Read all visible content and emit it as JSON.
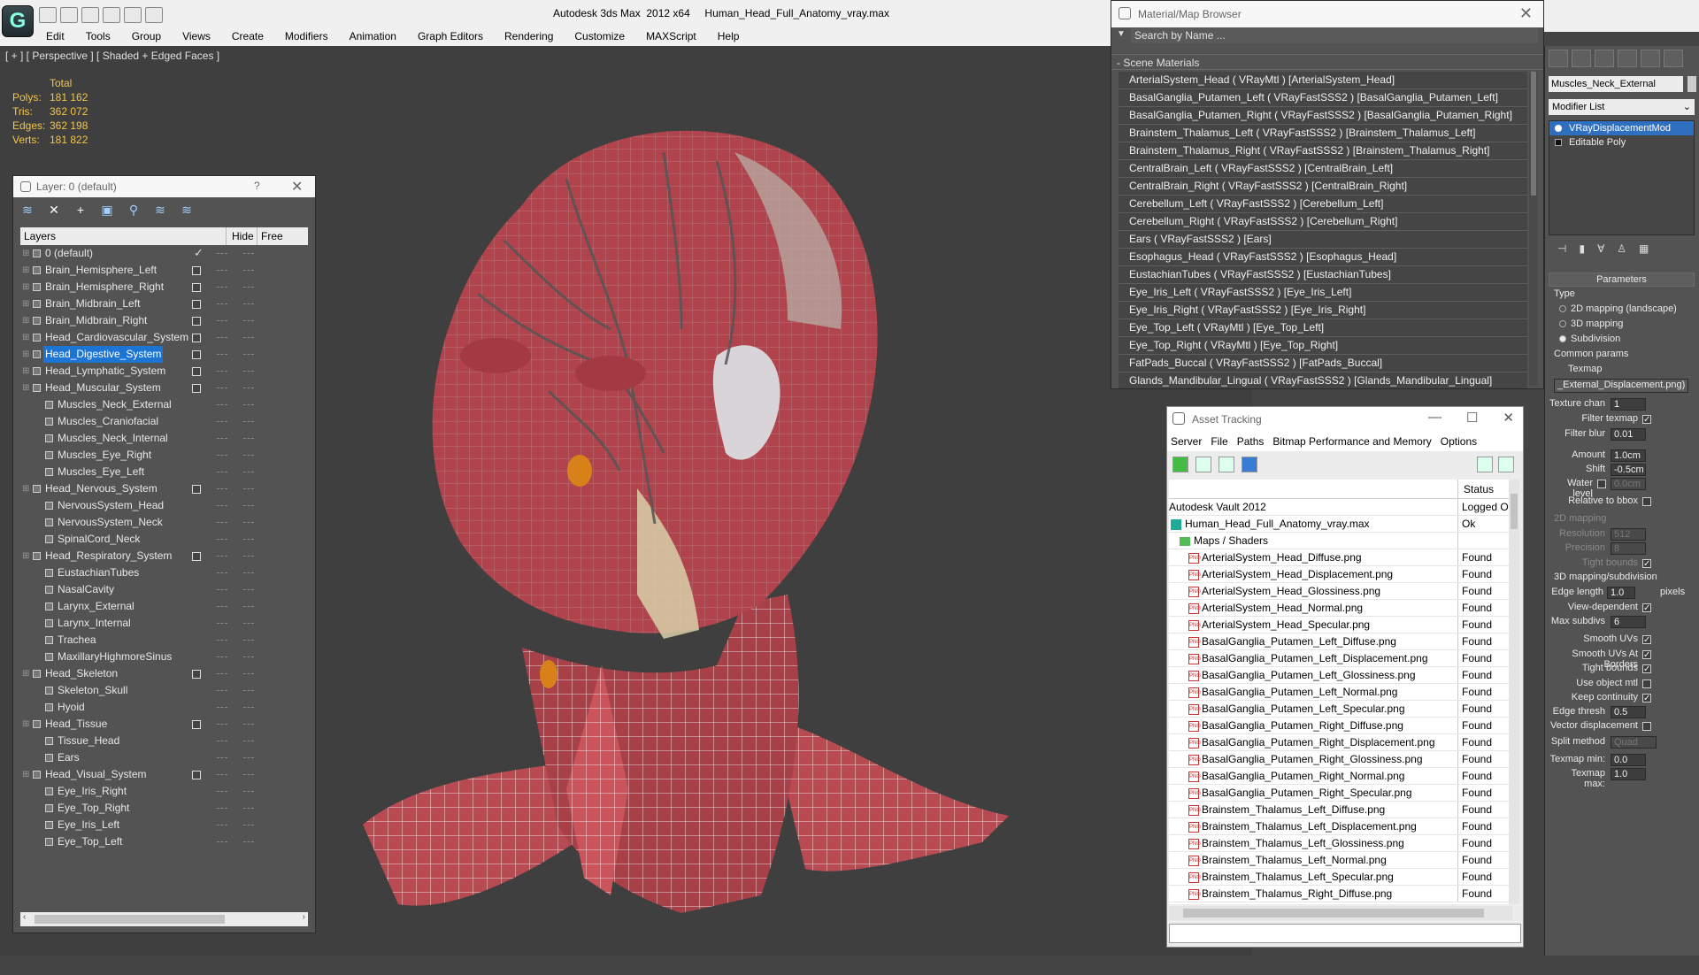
{
  "window": {
    "title": "Autodesk 3ds Max  2012 x64     Human_Head_Full_Anatomy_vray.max"
  },
  "menu": [
    "Edit",
    "Tools",
    "Group",
    "Views",
    "Create",
    "Modifiers",
    "Animation",
    "Graph Editors",
    "Rendering",
    "Customize",
    "MAXScript",
    "Help"
  ],
  "viewport": {
    "label": "[ + ] [ Perspective ] [ Shaded + Edged Faces ]",
    "stats": {
      "header": "Total",
      "rows": [
        {
          "k": "Polys:",
          "v": "181 162"
        },
        {
          "k": "Tris:",
          "v": "362 072"
        },
        {
          "k": "Edges:",
          "v": "362 198"
        },
        {
          "k": "Verts:",
          "v": "181 822"
        }
      ]
    }
  },
  "layer_panel": {
    "title": "Layer: 0 (default)",
    "help": "?",
    "col_layers": "Layers",
    "col_hide": "Hide",
    "col_freeze": "Free",
    "layers": [
      {
        "name": "0 (default)",
        "depth": 0,
        "check": "✓",
        "box": false
      },
      {
        "name": "Brain_Hemisphere_Left",
        "depth": 0,
        "box": true
      },
      {
        "name": "Brain_Hemisphere_Right",
        "depth": 0,
        "box": true
      },
      {
        "name": "Brain_Midbrain_Left",
        "depth": 0,
        "box": true
      },
      {
        "name": "Brain_Midbrain_Right",
        "depth": 0,
        "box": true
      },
      {
        "name": "Head_Cardiovascular_System",
        "depth": 0,
        "box": true
      },
      {
        "name": "Head_Digestive_System",
        "depth": 0,
        "box": true,
        "selected": true
      },
      {
        "name": "Head_Lymphatic_System",
        "depth": 0,
        "box": true
      },
      {
        "name": "Head_Muscular_System",
        "depth": 0,
        "box": true
      },
      {
        "name": "Muscles_Neck_External",
        "depth": 1
      },
      {
        "name": "Muscles_Craniofacial",
        "depth": 1
      },
      {
        "name": "Muscles_Neck_Internal",
        "depth": 1
      },
      {
        "name": "Muscles_Eye_Right",
        "depth": 1
      },
      {
        "name": "Muscles_Eye_Left",
        "depth": 1
      },
      {
        "name": "Head_Nervous_System",
        "depth": 0,
        "box": true
      },
      {
        "name": "NervousSystem_Head",
        "depth": 1
      },
      {
        "name": "NervousSystem_Neck",
        "depth": 1
      },
      {
        "name": "SpinalCord_Neck",
        "depth": 1
      },
      {
        "name": "Head_Respiratory_System",
        "depth": 0,
        "box": true
      },
      {
        "name": "EustachianTubes",
        "depth": 1
      },
      {
        "name": "NasalCavity",
        "depth": 1
      },
      {
        "name": "Larynx_External",
        "depth": 1
      },
      {
        "name": "Larynx_Internal",
        "depth": 1
      },
      {
        "name": "Trachea",
        "depth": 1
      },
      {
        "name": "MaxillaryHighmoreSinus",
        "depth": 1
      },
      {
        "name": "Head_Skeleton",
        "depth": 0,
        "box": true
      },
      {
        "name": "Skeleton_Skull",
        "depth": 1
      },
      {
        "name": "Hyoid",
        "depth": 1
      },
      {
        "name": "Head_Tissue",
        "depth": 0,
        "box": true
      },
      {
        "name": "Tissue_Head",
        "depth": 1
      },
      {
        "name": "Ears",
        "depth": 1
      },
      {
        "name": "Head_Visual_System",
        "depth": 0,
        "box": true
      },
      {
        "name": "Eye_Iris_Right",
        "depth": 1
      },
      {
        "name": "Eye_Top_Right",
        "depth": 1
      },
      {
        "name": "Eye_Iris_Left",
        "depth": 1
      },
      {
        "name": "Eye_Top_Left",
        "depth": 1
      }
    ]
  },
  "material_browser": {
    "title": "Material/Map Browser",
    "search_placeholder": "Search by Name ...",
    "section": "- Scene Materials",
    "materials": [
      "ArterialSystem_Head  ( VRayMtl )  [ArterialSystem_Head]",
      "BasalGanglia_Putamen_Left  ( VRayFastSSS2 )  [BasalGanglia_Putamen_Left]",
      "BasalGanglia_Putamen_Right  ( VRayFastSSS2 )  [BasalGanglia_Putamen_Right]",
      "Brainstem_Thalamus_Left  ( VRayFastSSS2 )  [Brainstem_Thalamus_Left]",
      "Brainstem_Thalamus_Right  ( VRayFastSSS2 )  [Brainstem_Thalamus_Right]",
      "CentralBrain_Left  ( VRayFastSSS2 )  [CentralBrain_Left]",
      "CentralBrain_Right  ( VRayFastSSS2 )  [CentralBrain_Right]",
      "Cerebellum_Left  ( VRayFastSSS2 )  [Cerebellum_Left]",
      "Cerebellum_Right  ( VRayFastSSS2 )  [Cerebellum_Right]",
      "Ears  ( VRayFastSSS2 )  [Ears]",
      "Esophagus_Head  ( VRayFastSSS2 )  [Esophagus_Head]",
      "EustachianTubes  ( VRayFastSSS2 )  [EustachianTubes]",
      "Eye_Iris_Left  ( VRayFastSSS2 )  [Eye_Iris_Left]",
      "Eye_Iris_Right  ( VRayFastSSS2 )  [Eye_Iris_Right]",
      "Eye_Top_Left  ( VRayMtl )  [Eye_Top_Left]",
      "Eye_Top_Right  ( VRayMtl )  [Eye_Top_Right]",
      "FatPads_Buccal  ( VRayFastSSS2 )  [FatPads_Buccal]",
      "Glands_Mandibular_Lingual  ( VRayFastSSS2 )  [Glands_Mandibular_Lingual]"
    ]
  },
  "asset_tracking": {
    "title": "Asset Tracking",
    "menu": [
      "Server",
      "File",
      "Paths",
      "Bitmap Performance and Memory",
      "Options"
    ],
    "col_status": "Status",
    "rows": [
      {
        "name": "Autodesk Vault 2012",
        "status": "Logged O",
        "kind": "vault"
      },
      {
        "name": "Human_Head_Full_Anatomy_vray.max",
        "status": "Ok",
        "kind": "max"
      },
      {
        "name": "Maps / Shaders",
        "status": "",
        "kind": "folder"
      },
      {
        "name": "ArterialSystem_Head_Diffuse.png",
        "status": "Found",
        "kind": "png"
      },
      {
        "name": "ArterialSystem_Head_Displacement.png",
        "status": "Found",
        "kind": "png"
      },
      {
        "name": "ArterialSystem_Head_Glossiness.png",
        "status": "Found",
        "kind": "png"
      },
      {
        "name": "ArterialSystem_Head_Normal.png",
        "status": "Found",
        "kind": "png"
      },
      {
        "name": "ArterialSystem_Head_Specular.png",
        "status": "Found",
        "kind": "png"
      },
      {
        "name": "BasalGanglia_Putamen_Left_Diffuse.png",
        "status": "Found",
        "kind": "png"
      },
      {
        "name": "BasalGanglia_Putamen_Left_Displacement.png",
        "status": "Found",
        "kind": "png"
      },
      {
        "name": "BasalGanglia_Putamen_Left_Glossiness.png",
        "status": "Found",
        "kind": "png"
      },
      {
        "name": "BasalGanglia_Putamen_Left_Normal.png",
        "status": "Found",
        "kind": "png"
      },
      {
        "name": "BasalGanglia_Putamen_Left_Specular.png",
        "status": "Found",
        "kind": "png"
      },
      {
        "name": "BasalGanglia_Putamen_Right_Diffuse.png",
        "status": "Found",
        "kind": "png"
      },
      {
        "name": "BasalGanglia_Putamen_Right_Displacement.png",
        "status": "Found",
        "kind": "png"
      },
      {
        "name": "BasalGanglia_Putamen_Right_Glossiness.png",
        "status": "Found",
        "kind": "png"
      },
      {
        "name": "BasalGanglia_Putamen_Right_Normal.png",
        "status": "Found",
        "kind": "png"
      },
      {
        "name": "BasalGanglia_Putamen_Right_Specular.png",
        "status": "Found",
        "kind": "png"
      },
      {
        "name": "Brainstem_Thalamus_Left_Diffuse.png",
        "status": "Found",
        "kind": "png"
      },
      {
        "name": "Brainstem_Thalamus_Left_Displacement.png",
        "status": "Found",
        "kind": "png"
      },
      {
        "name": "Brainstem_Thalamus_Left_Glossiness.png",
        "status": "Found",
        "kind": "png"
      },
      {
        "name": "Brainstem_Thalamus_Left_Normal.png",
        "status": "Found",
        "kind": "png"
      },
      {
        "name": "Brainstem_Thalamus_Left_Specular.png",
        "status": "Found",
        "kind": "png"
      },
      {
        "name": "Brainstem_Thalamus_Right_Diffuse.png",
        "status": "Found",
        "kind": "png"
      }
    ]
  },
  "command_panel": {
    "object_name": "Muscles_Neck_External",
    "modifier_list": "Modifier List",
    "stack": [
      "VRayDisplacementMod",
      "Editable Poly"
    ],
    "parameters_title": "Parameters",
    "type_label": "Type",
    "type_options": [
      "2D mapping (landscape)",
      "3D mapping",
      "Subdivision"
    ],
    "type_selected": "Subdivision",
    "common_params": "Common params",
    "texmap_label": "Texmap",
    "texmap_value": "_External_Displacement.png)",
    "texture_chan_label": "Texture chan",
    "texture_chan_value": "1",
    "filter_texmap_label": "Filter texmap",
    "filter_blur_label": "Filter blur",
    "filter_blur_value": "0.01",
    "amount_label": "Amount",
    "amount_value": "1.0cm",
    "shift_label": "Shift",
    "shift_value": "-0.5cm",
    "water_level_label": "Water level",
    "water_level_value": "0.0cm",
    "relative_bbox_label": "Relative to bbox",
    "mapping2d_title": "2D mapping",
    "resolution_label": "Resolution",
    "resolution_value": "512",
    "precision_label": "Precision",
    "precision_value": "8",
    "tight_bounds_label": "Tight bounds",
    "mapping3d_title": "3D mapping/subdivision",
    "edge_length_label": "Edge length",
    "edge_length_value": "1.0",
    "pixels_label": "pixels",
    "view_dependent_label": "View-dependent",
    "max_subdivs_label": "Max subdivs",
    "max_subdivs_value": "6",
    "smooth_uvs_label": "Smooth UVs",
    "smooth_uvs_borders_label": "Smooth UVs At Borders",
    "tight_bounds2_label": "Tight bounds",
    "use_object_mtl_label": "Use object mtl",
    "keep_continuity_label": "Keep continuity",
    "edge_thresh_label": "Edge thresh",
    "edge_thresh_value": "0.5",
    "vector_disp_label": "Vector displacement",
    "split_method_label": "Split method",
    "split_method_value": "Quad",
    "texmap_min_label": "Texmap min:",
    "texmap_min_value": "0.0",
    "texmap_max_label": "Texmap max:",
    "texmap_max_value": "1.0"
  }
}
